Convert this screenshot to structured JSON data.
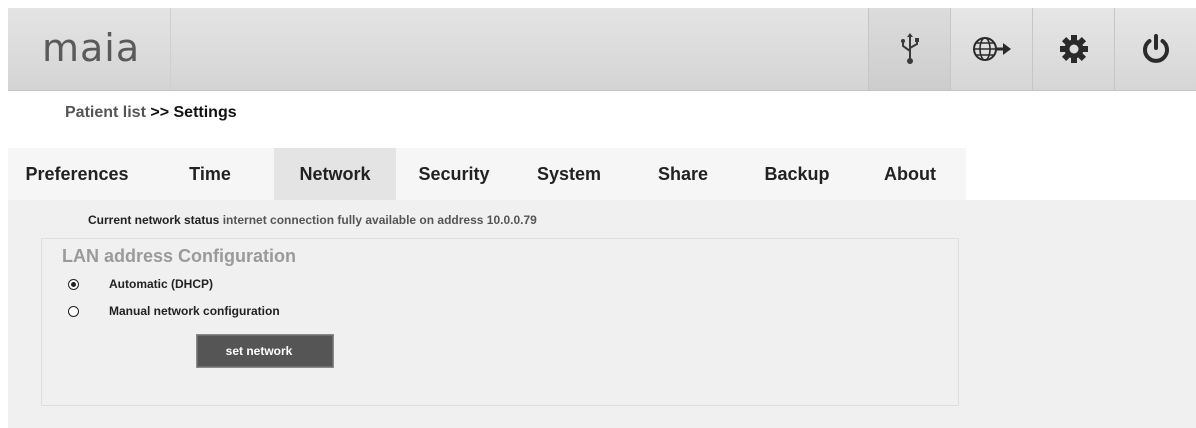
{
  "app": {
    "logo": "maia"
  },
  "toolbar": {
    "icons": [
      {
        "name": "usb-icon"
      },
      {
        "name": "globe-network-icon"
      },
      {
        "name": "gear-icon"
      },
      {
        "name": "power-icon"
      }
    ]
  },
  "breadcrumb": {
    "parent": "Patient list",
    "separator": ">>",
    "current": "Settings"
  },
  "tabs": [
    {
      "label": "Preferences",
      "active": false
    },
    {
      "label": "Time",
      "active": false
    },
    {
      "label": "Network",
      "active": true
    },
    {
      "label": "Security",
      "active": false
    },
    {
      "label": "System",
      "active": false
    },
    {
      "label": "Share",
      "active": false
    },
    {
      "label": "Backup",
      "active": false
    },
    {
      "label": "About",
      "active": false
    }
  ],
  "network": {
    "status_label": "Current network status",
    "status_value": "internet connection fully available on address 10.0.0.79",
    "lan_title": "LAN address Configuration",
    "options": [
      {
        "label": "Automatic (DHCP)",
        "checked": true
      },
      {
        "label": "Manual network configuration",
        "checked": false
      }
    ],
    "set_button": "set network"
  },
  "colors": {
    "topbar": "#d9d9d9",
    "panel": "#f0f0f0",
    "active_tab": "#e4e4e4",
    "button": "#555555"
  }
}
